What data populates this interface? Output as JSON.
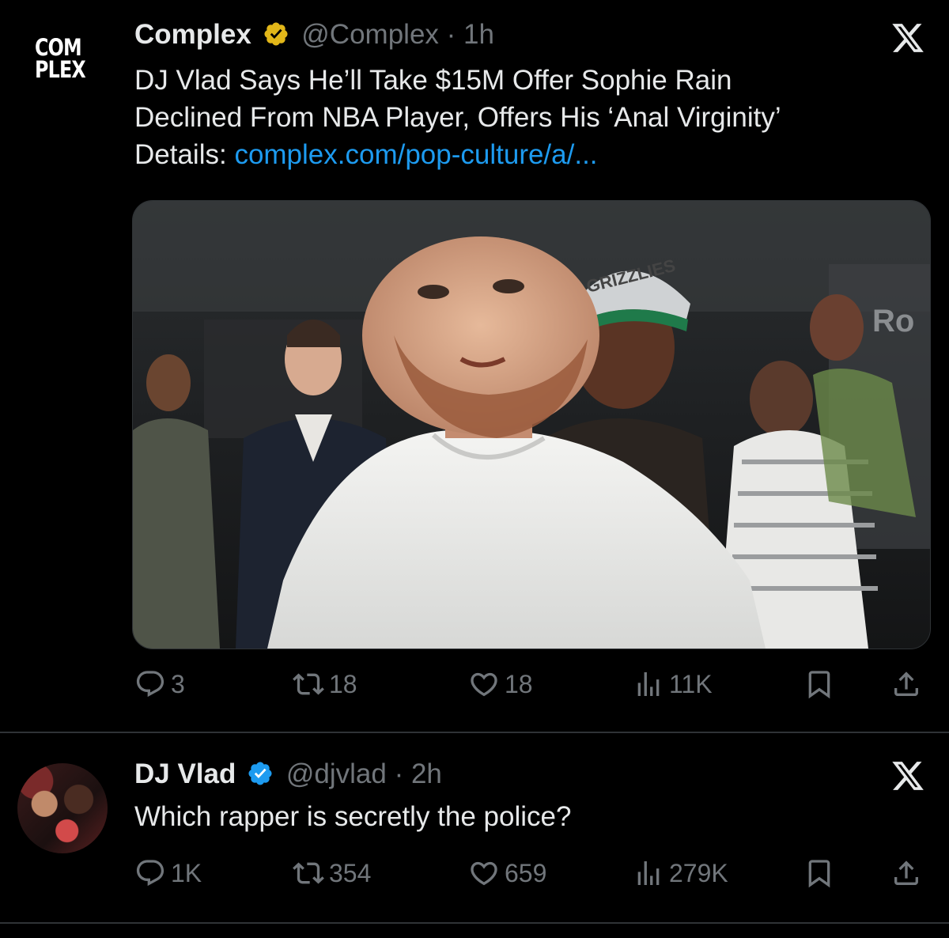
{
  "tweets": [
    {
      "display_name": "Complex",
      "handle": "@Complex",
      "separator": "·",
      "time": "1h",
      "avatar": {
        "type": "logo",
        "line1": "COM",
        "line2": "PLEX"
      },
      "text_line1": "DJ Vlad Says He’ll Take $15M Offer Sophie Rain",
      "text_line2": "Declined From NBA Player, Offers His ‘Anal Virginity’",
      "details_label": "Details: ",
      "link_text": "complex.com/pop-culture/a/...",
      "media_text": {
        "cap": "GRIZZLIES",
        "sign": "Ro"
      },
      "stats": {
        "replies": "3",
        "reposts": "18",
        "likes": "18",
        "views": "11K"
      }
    },
    {
      "display_name": "DJ Vlad",
      "handle": "@djvlad",
      "separator": "·",
      "time": "2h",
      "text": "Which rapper is secretly the police?",
      "stats": {
        "replies": "1K",
        "reposts": "354",
        "likes": "659",
        "views": "279K"
      }
    }
  ],
  "colors": {
    "background": "#000000",
    "text": "#e7e9ea",
    "secondary": "#71767b",
    "link": "#1d9bf0",
    "verified": "#e2b719",
    "verified_vlad": "#1d9bf0",
    "divider": "#2f3336"
  },
  "icons": [
    "reply-icon",
    "repost-icon",
    "like-icon",
    "views-icon",
    "bookmark-icon",
    "share-icon",
    "x-logo-icon",
    "verified-badge-icon"
  ]
}
